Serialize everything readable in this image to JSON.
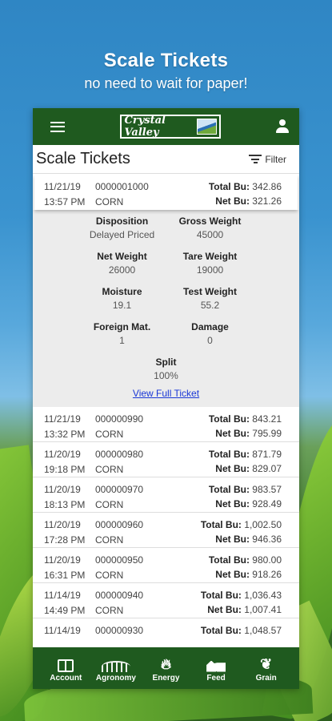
{
  "hero": {
    "title": "Scale Tickets",
    "subtitle": "no need to wait for paper!"
  },
  "appbar": {
    "logo_text": "Crystal Valley"
  },
  "screen": {
    "title": "Scale Tickets",
    "filter_label": "Filter"
  },
  "selected_ticket": {
    "date": "11/21/19",
    "time": "13:57 PM",
    "number": "0000001000",
    "commodity": "CORN",
    "total_label": "Total Bu:",
    "total": "342.86",
    "net_label": "Net Bu:",
    "net": "321.26"
  },
  "details": {
    "disposition_label": "Disposition",
    "disposition": "Delayed Priced",
    "gross_label": "Gross Weight",
    "gross": "45000",
    "net_weight_label": "Net Weight",
    "net_weight": "26000",
    "tare_label": "Tare Weight",
    "tare": "19000",
    "moisture_label": "Moisture",
    "moisture": "19.1",
    "test_weight_label": "Test Weight",
    "test_weight": "55.2",
    "foreign_label": "Foreign Mat.",
    "foreign": "1",
    "damage_label": "Damage",
    "damage": "0",
    "split_label": "Split",
    "split": "100%",
    "view_link": "View Full Ticket"
  },
  "tickets": [
    {
      "date": "11/21/19",
      "time": "13:32 PM",
      "number": "000000990",
      "commodity": "CORN",
      "total_label": "Total Bu:",
      "total": "843.21",
      "net_label": "Net Bu:",
      "net": "795.99"
    },
    {
      "date": "11/20/19",
      "time": "19:18 PM",
      "number": "000000980",
      "commodity": "CORN",
      "total_label": "Total Bu:",
      "total": "871.79",
      "net_label": "Net Bu:",
      "net": "829.07"
    },
    {
      "date": "11/20/19",
      "time": "18:13 PM",
      "number": "000000970",
      "commodity": "CORN",
      "total_label": "Total Bu:",
      "total": "983.57",
      "net_label": "Net Bu:",
      "net": "928.49"
    },
    {
      "date": "11/20/19",
      "time": "17:28 PM",
      "number": "000000960",
      "commodity": "CORN",
      "total_label": "Total Bu:",
      "total": "1,002.50",
      "net_label": "Net Bu:",
      "net": "946.36"
    },
    {
      "date": "11/20/19",
      "time": "16:31 PM",
      "number": "000000950",
      "commodity": "CORN",
      "total_label": "Total Bu:",
      "total": "980.00",
      "net_label": "Net Bu:",
      "net": "918.26"
    },
    {
      "date": "11/14/19",
      "time": "14:49 PM",
      "number": "000000940",
      "commodity": "CORN",
      "total_label": "Total Bu:",
      "total": "1,036.43",
      "net_label": "Net Bu:",
      "net": "1,007.41"
    },
    {
      "date": "11/14/19",
      "time": "",
      "number": "000000930",
      "commodity": "",
      "total_label": "Total Bu:",
      "total": "1,048.57",
      "net_label": "",
      "net": ""
    }
  ],
  "nav": [
    {
      "label": "Account",
      "icon": "account-book-icon"
    },
    {
      "label": "Agronomy",
      "icon": "agronomy-field-icon"
    },
    {
      "label": "Energy",
      "icon": "energy-flame-icon"
    },
    {
      "label": "Feed",
      "icon": "feed-barn-icon"
    },
    {
      "label": "Grain",
      "icon": "grain-wheat-icon"
    }
  ]
}
